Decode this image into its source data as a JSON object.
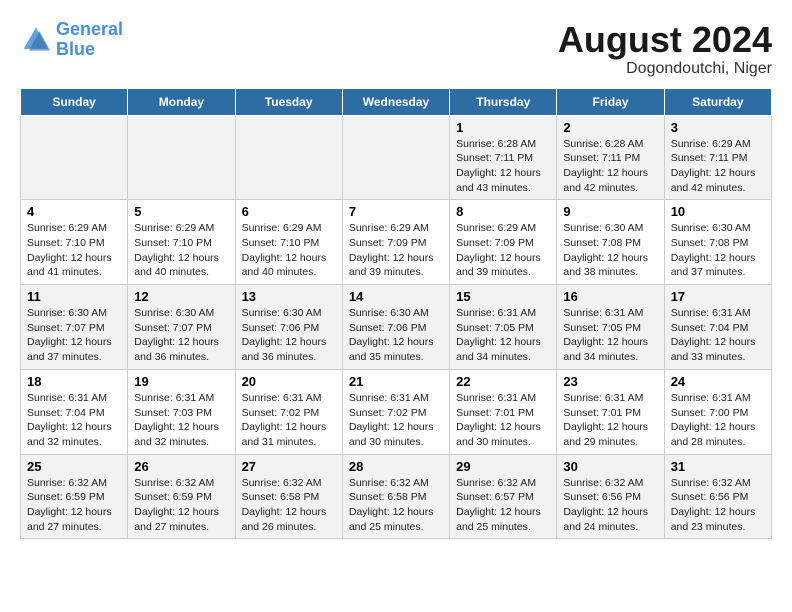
{
  "logo": {
    "line1": "General",
    "line2": "Blue"
  },
  "title": "August 2024",
  "subtitle": "Dogondoutchi, Niger",
  "days_of_week": [
    "Sunday",
    "Monday",
    "Tuesday",
    "Wednesday",
    "Thursday",
    "Friday",
    "Saturday"
  ],
  "weeks": [
    [
      {
        "day": "",
        "info": ""
      },
      {
        "day": "",
        "info": ""
      },
      {
        "day": "",
        "info": ""
      },
      {
        "day": "",
        "info": ""
      },
      {
        "day": "1",
        "info": "Sunrise: 6:28 AM\nSunset: 7:11 PM\nDaylight: 12 hours and 43 minutes."
      },
      {
        "day": "2",
        "info": "Sunrise: 6:28 AM\nSunset: 7:11 PM\nDaylight: 12 hours and 42 minutes."
      },
      {
        "day": "3",
        "info": "Sunrise: 6:29 AM\nSunset: 7:11 PM\nDaylight: 12 hours and 42 minutes."
      }
    ],
    [
      {
        "day": "4",
        "info": "Sunrise: 6:29 AM\nSunset: 7:10 PM\nDaylight: 12 hours and 41 minutes."
      },
      {
        "day": "5",
        "info": "Sunrise: 6:29 AM\nSunset: 7:10 PM\nDaylight: 12 hours and 40 minutes."
      },
      {
        "day": "6",
        "info": "Sunrise: 6:29 AM\nSunset: 7:10 PM\nDaylight: 12 hours and 40 minutes."
      },
      {
        "day": "7",
        "info": "Sunrise: 6:29 AM\nSunset: 7:09 PM\nDaylight: 12 hours and 39 minutes."
      },
      {
        "day": "8",
        "info": "Sunrise: 6:29 AM\nSunset: 7:09 PM\nDaylight: 12 hours and 39 minutes."
      },
      {
        "day": "9",
        "info": "Sunrise: 6:30 AM\nSunset: 7:08 PM\nDaylight: 12 hours and 38 minutes."
      },
      {
        "day": "10",
        "info": "Sunrise: 6:30 AM\nSunset: 7:08 PM\nDaylight: 12 hours and 37 minutes."
      }
    ],
    [
      {
        "day": "11",
        "info": "Sunrise: 6:30 AM\nSunset: 7:07 PM\nDaylight: 12 hours and 37 minutes."
      },
      {
        "day": "12",
        "info": "Sunrise: 6:30 AM\nSunset: 7:07 PM\nDaylight: 12 hours and 36 minutes."
      },
      {
        "day": "13",
        "info": "Sunrise: 6:30 AM\nSunset: 7:06 PM\nDaylight: 12 hours and 36 minutes."
      },
      {
        "day": "14",
        "info": "Sunrise: 6:30 AM\nSunset: 7:06 PM\nDaylight: 12 hours and 35 minutes."
      },
      {
        "day": "15",
        "info": "Sunrise: 6:31 AM\nSunset: 7:05 PM\nDaylight: 12 hours and 34 minutes."
      },
      {
        "day": "16",
        "info": "Sunrise: 6:31 AM\nSunset: 7:05 PM\nDaylight: 12 hours and 34 minutes."
      },
      {
        "day": "17",
        "info": "Sunrise: 6:31 AM\nSunset: 7:04 PM\nDaylight: 12 hours and 33 minutes."
      }
    ],
    [
      {
        "day": "18",
        "info": "Sunrise: 6:31 AM\nSunset: 7:04 PM\nDaylight: 12 hours and 32 minutes."
      },
      {
        "day": "19",
        "info": "Sunrise: 6:31 AM\nSunset: 7:03 PM\nDaylight: 12 hours and 32 minutes."
      },
      {
        "day": "20",
        "info": "Sunrise: 6:31 AM\nSunset: 7:02 PM\nDaylight: 12 hours and 31 minutes."
      },
      {
        "day": "21",
        "info": "Sunrise: 6:31 AM\nSunset: 7:02 PM\nDaylight: 12 hours and 30 minutes."
      },
      {
        "day": "22",
        "info": "Sunrise: 6:31 AM\nSunset: 7:01 PM\nDaylight: 12 hours and 30 minutes."
      },
      {
        "day": "23",
        "info": "Sunrise: 6:31 AM\nSunset: 7:01 PM\nDaylight: 12 hours and 29 minutes."
      },
      {
        "day": "24",
        "info": "Sunrise: 6:31 AM\nSunset: 7:00 PM\nDaylight: 12 hours and 28 minutes."
      }
    ],
    [
      {
        "day": "25",
        "info": "Sunrise: 6:32 AM\nSunset: 6:59 PM\nDaylight: 12 hours and 27 minutes."
      },
      {
        "day": "26",
        "info": "Sunrise: 6:32 AM\nSunset: 6:59 PM\nDaylight: 12 hours and 27 minutes."
      },
      {
        "day": "27",
        "info": "Sunrise: 6:32 AM\nSunset: 6:58 PM\nDaylight: 12 hours and 26 minutes."
      },
      {
        "day": "28",
        "info": "Sunrise: 6:32 AM\nSunset: 6:58 PM\nDaylight: 12 hours and 25 minutes."
      },
      {
        "day": "29",
        "info": "Sunrise: 6:32 AM\nSunset: 6:57 PM\nDaylight: 12 hours and 25 minutes."
      },
      {
        "day": "30",
        "info": "Sunrise: 6:32 AM\nSunset: 6:56 PM\nDaylight: 12 hours and 24 minutes."
      },
      {
        "day": "31",
        "info": "Sunrise: 6:32 AM\nSunset: 6:56 PM\nDaylight: 12 hours and 23 minutes."
      }
    ]
  ]
}
